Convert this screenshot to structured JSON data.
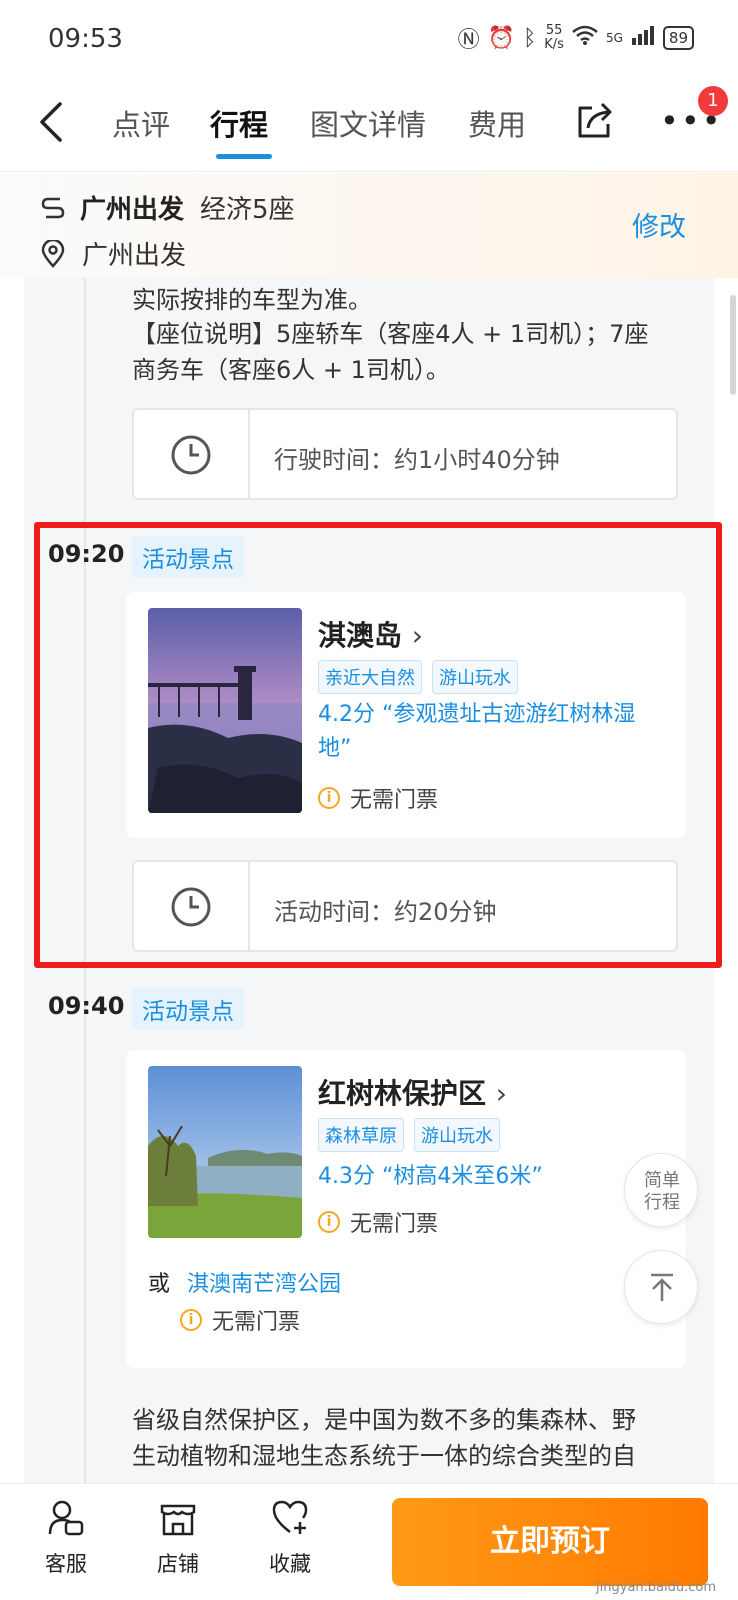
{
  "status_bar": {
    "time": "09:53",
    "net_speed_value": "55",
    "net_speed_unit": "K/s",
    "battery": "89",
    "network": "5G"
  },
  "nav": {
    "tabs": [
      "点评",
      "行程",
      "图文详情",
      "费用"
    ],
    "active_tab": "行程",
    "notification_count": "1"
  },
  "trip_info": {
    "departure": "广州出发",
    "vehicle": "经济5座",
    "location": "广州出发",
    "modify_label": "修改"
  },
  "transport": {
    "desc_lines": [
      "实际按排的车型为准。",
      "【座位说明】5座轿车（客座4人 + 1司机）；7座",
      "商务车（客座6人 + 1司机）。"
    ],
    "duration": "行驶时间：约1小时40分钟"
  },
  "items": [
    {
      "time": "09:20",
      "type": "活动景点",
      "name": "淇澳岛",
      "tags": [
        "亲近大自然",
        "游山玩水"
      ],
      "rating_line1": "4.2分 “参观遗址古迹游红树林湿",
      "rating_line2": "地”",
      "ticket": "无需门票",
      "duration": "活动时间：约20分钟"
    },
    {
      "time": "09:40",
      "type": "活动景点",
      "name": "红树林保护区",
      "tags": [
        "森林草原",
        "游山玩水"
      ],
      "rating_line1": "4.3分 “树高4米至6米”",
      "ticket": "无需门票",
      "alt_prefix": "或",
      "alt_name": "淇澳南芒湾公园",
      "alt_ticket": "无需门票",
      "desc_line1": "省级自然保护区，是中国为数不多的集森林、野",
      "desc_line2": "生动植物和湿地生态系统于一体的综合类型的自"
    }
  ],
  "floating": {
    "simple_line1": "简单",
    "simple_line2": "行程"
  },
  "bottom_bar": {
    "service_label": "客服",
    "shop_label": "店铺",
    "favorite_label": "收藏",
    "book_label": "立即预订",
    "watermark": "jingyan.baidu.com"
  },
  "colors": {
    "accent": "#1a8fe0",
    "book": "#ff8a00",
    "highlight": "#ee1c1c",
    "badge": "#f23a3a"
  }
}
